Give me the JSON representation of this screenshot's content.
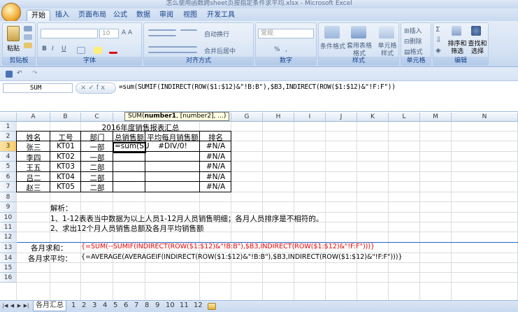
{
  "window_title": "怎么使用函数跨sheet页按指定条件求平均.xlsx - Microsoft Excel",
  "ribbon_tabs": [
    "开始",
    "插入",
    "页面布局",
    "公式",
    "数据",
    "审阅",
    "视图",
    "开发工具"
  ],
  "ribbon": {
    "clipboard": {
      "paste": "粘贴",
      "label": "剪贴板"
    },
    "font": {
      "size": "10",
      "label": "字体",
      "bold": "B",
      "italic": "I",
      "underline": "U"
    },
    "alignment": {
      "wrap": "自动换行",
      "merge": "合并后居中",
      "label": "对齐方式"
    },
    "number": {
      "format": "常规",
      "pct": "%",
      "comma": ",",
      "label": "数字"
    },
    "styles": {
      "cond": "条件格式",
      "table": "套用表格格式",
      "cell": "单元格样式",
      "label": "样式"
    },
    "cells": {
      "insert": "插入",
      "delete": "删除",
      "format": "格式",
      "label": "单元格"
    },
    "editing": {
      "sort": "排序和筛选",
      "find": "查找和选择",
      "label": "编辑"
    }
  },
  "formula_bar": {
    "name_box": "SUM",
    "fx": "×✓fx",
    "formula": "=sum(SUMIF(INDIRECT(ROW($1:$12)&\"!B:B\"),$B3,INDIRECT(ROW($1:$12)&\"!F:F\"))",
    "tooltip_func": "SUM(",
    "tooltip_arg1": "number1",
    "tooltip_rest": ", [number2], ...)"
  },
  "columns": [
    "A",
    "B",
    "C",
    "D",
    "E",
    "F",
    "G",
    "H",
    "I",
    "J",
    "K",
    "L",
    "M",
    "N"
  ],
  "rows": [
    "1",
    "2",
    "3",
    "4",
    "5",
    "6",
    "7",
    "8",
    "9",
    "10",
    "11",
    "12",
    "13",
    "14",
    "15",
    "16"
  ],
  "table": {
    "title": "2016年度销售报表汇总",
    "headers": [
      "姓名",
      "工号",
      "部门",
      "总销售额",
      "平均每月销售额",
      "排名"
    ],
    "data": [
      [
        "张三",
        "KT01",
        "一部",
        "=sum(SU",
        "#DIV/0!",
        "#N/A"
      ],
      [
        "李四",
        "KT02",
        "一部",
        "",
        "",
        "#N/A"
      ],
      [
        "王五",
        "KT03",
        "二部",
        "",
        "",
        "#N/A"
      ],
      [
        "吕二",
        "KT04",
        "二部",
        "",
        "",
        "#N/A"
      ],
      [
        "赵三",
        "KT05",
        "二部",
        "",
        "",
        "#N/A"
      ]
    ]
  },
  "notes": {
    "heading": "解析：",
    "line1": "1、1-12表表当中数据为以上人员1-12月人员销售明细；各月人员排序是不相符的。",
    "line2": "2、求出12个月人员销售总额及各月平均销售额"
  },
  "formulas": {
    "sum_label": "各月求和：",
    "sum_formula": "{=SUM(--SUMIF(INDIRECT(ROW($1:$12)&\"!B:B\"),$B3,INDIRECT(ROW($1:$12)&\"!F:F\")))}",
    "avg_label": "各月求平均：",
    "avg_formula": "{=AVERAGE(AVERAGEIF(INDIRECT(ROW($1:$12)&\"!B:B\"),$B3,INDIRECT(ROW($1:$12)&\"!F:F\")))}"
  },
  "sheet_tabs": {
    "active": "各月汇总",
    "others": [
      "1",
      "2",
      "3",
      "4",
      "5",
      "6",
      "7",
      "8",
      "9",
      "10",
      "11",
      "12"
    ]
  }
}
